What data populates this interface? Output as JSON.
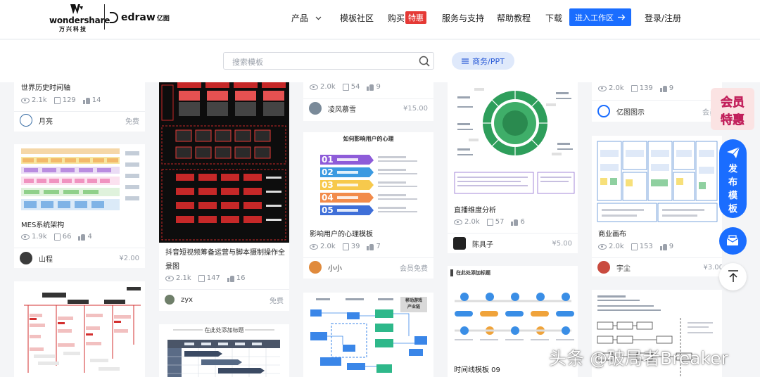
{
  "header": {
    "brand_wondershare": "wondershare",
    "brand_wondershare_cn": "万兴科技",
    "brand_edraw": "edraw",
    "brand_edraw_cn": "亿图",
    "nav": [
      {
        "label": "产品"
      },
      {
        "label": "模板社区"
      },
      {
        "label": "购买",
        "badge": "特惠"
      },
      {
        "label": "服务与支持"
      },
      {
        "label": "帮助教程"
      },
      {
        "label": "下载"
      }
    ],
    "enter_button": "进入工作区",
    "login": "登录/注册",
    "accent_color": "#1a6dff"
  },
  "search": {
    "placeholder": "搜索模板",
    "category_pill": "商务/PPT"
  },
  "cards": [
    {
      "title": "世界历史时间轴",
      "views": "2.1k",
      "copies": "129",
      "likes": "14",
      "author": "月亮",
      "price": "免费"
    },
    {
      "title": "MES系统架构",
      "views": "1.9k",
      "copies": "66",
      "likes": "4",
      "author": "山程",
      "price": "¥2.00"
    },
    {
      "title_line1": "抖音短视频筹备运营与脚本摄制操作全",
      "title_line2": "景图",
      "views": "2.1k",
      "copies": "147",
      "likes": "16",
      "author": "zyx",
      "price": "免费"
    },
    {
      "views": "2.0k",
      "copies": "54",
      "likes": "9",
      "author": "凌风慕雪",
      "price": "¥15.00"
    },
    {
      "title": "影响用户的心理模板",
      "thumb_title": "如何影响用户的心理",
      "steps": [
        "01",
        "02",
        "03",
        "04",
        "05"
      ],
      "views": "2.0k",
      "copies": "39",
      "likes": "7",
      "author": "小小",
      "price": "会员免费"
    },
    {
      "title": "直播维度分析",
      "views": "2.0k",
      "copies": "57",
      "likes": "6",
      "author": "陈具子",
      "price": "¥5.00"
    },
    {
      "title": "时间线模板 09",
      "thumb_title": "在此处添加标题"
    },
    {
      "views": "2.0k",
      "copies": "139",
      "likes": "9",
      "author": "亿图图示",
      "price": "会员免"
    },
    {
      "title": "商业画布",
      "views": "2.0k",
      "copies": "153",
      "likes": "9",
      "author": "宇尘",
      "price": "¥3.00"
    },
    {
      "thumb_title": "在此处添加标题"
    },
    {
      "thumb_badge_line1": "移动游戏",
      "thumb_badge_line2": "产业链"
    }
  ],
  "float": {
    "vip_line1": "会员",
    "vip_line2": "特惠",
    "publish_chars": [
      "发",
      "布",
      "模",
      "板"
    ]
  },
  "watermark": "头条 @破局者Breaker"
}
